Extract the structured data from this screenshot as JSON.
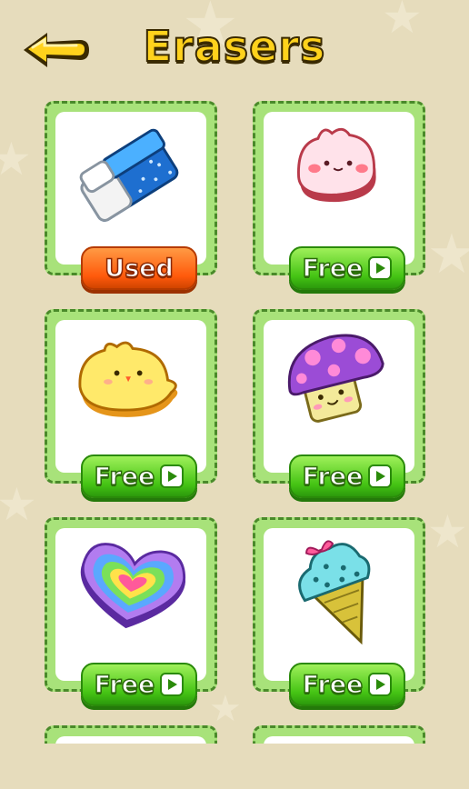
{
  "screen": {
    "title": "Erasers",
    "colors": {
      "background": "#e6dcbc",
      "title": "#ffd21c",
      "card_frame": "#a8e27a",
      "free_button": "#45c414",
      "used_button": "#ff5a0c"
    },
    "icons": {
      "back": "back-arrow-icon",
      "play": "play-icon"
    }
  },
  "erasers": [
    {
      "name": "blue-block-eraser-icon",
      "button_label": "Used",
      "button_state": "used"
    },
    {
      "name": "pink-bunny-eraser-icon",
      "button_label": "Free",
      "button_state": "free"
    },
    {
      "name": "yellow-chick-eraser-icon",
      "button_label": "Free",
      "button_state": "free"
    },
    {
      "name": "purple-mushroom-eraser-icon",
      "button_label": "Free",
      "button_state": "free"
    },
    {
      "name": "rainbow-heart-eraser-icon",
      "button_label": "Free",
      "button_state": "free"
    },
    {
      "name": "ice-cream-cone-eraser-icon",
      "button_label": "Free",
      "button_state": "free"
    }
  ]
}
